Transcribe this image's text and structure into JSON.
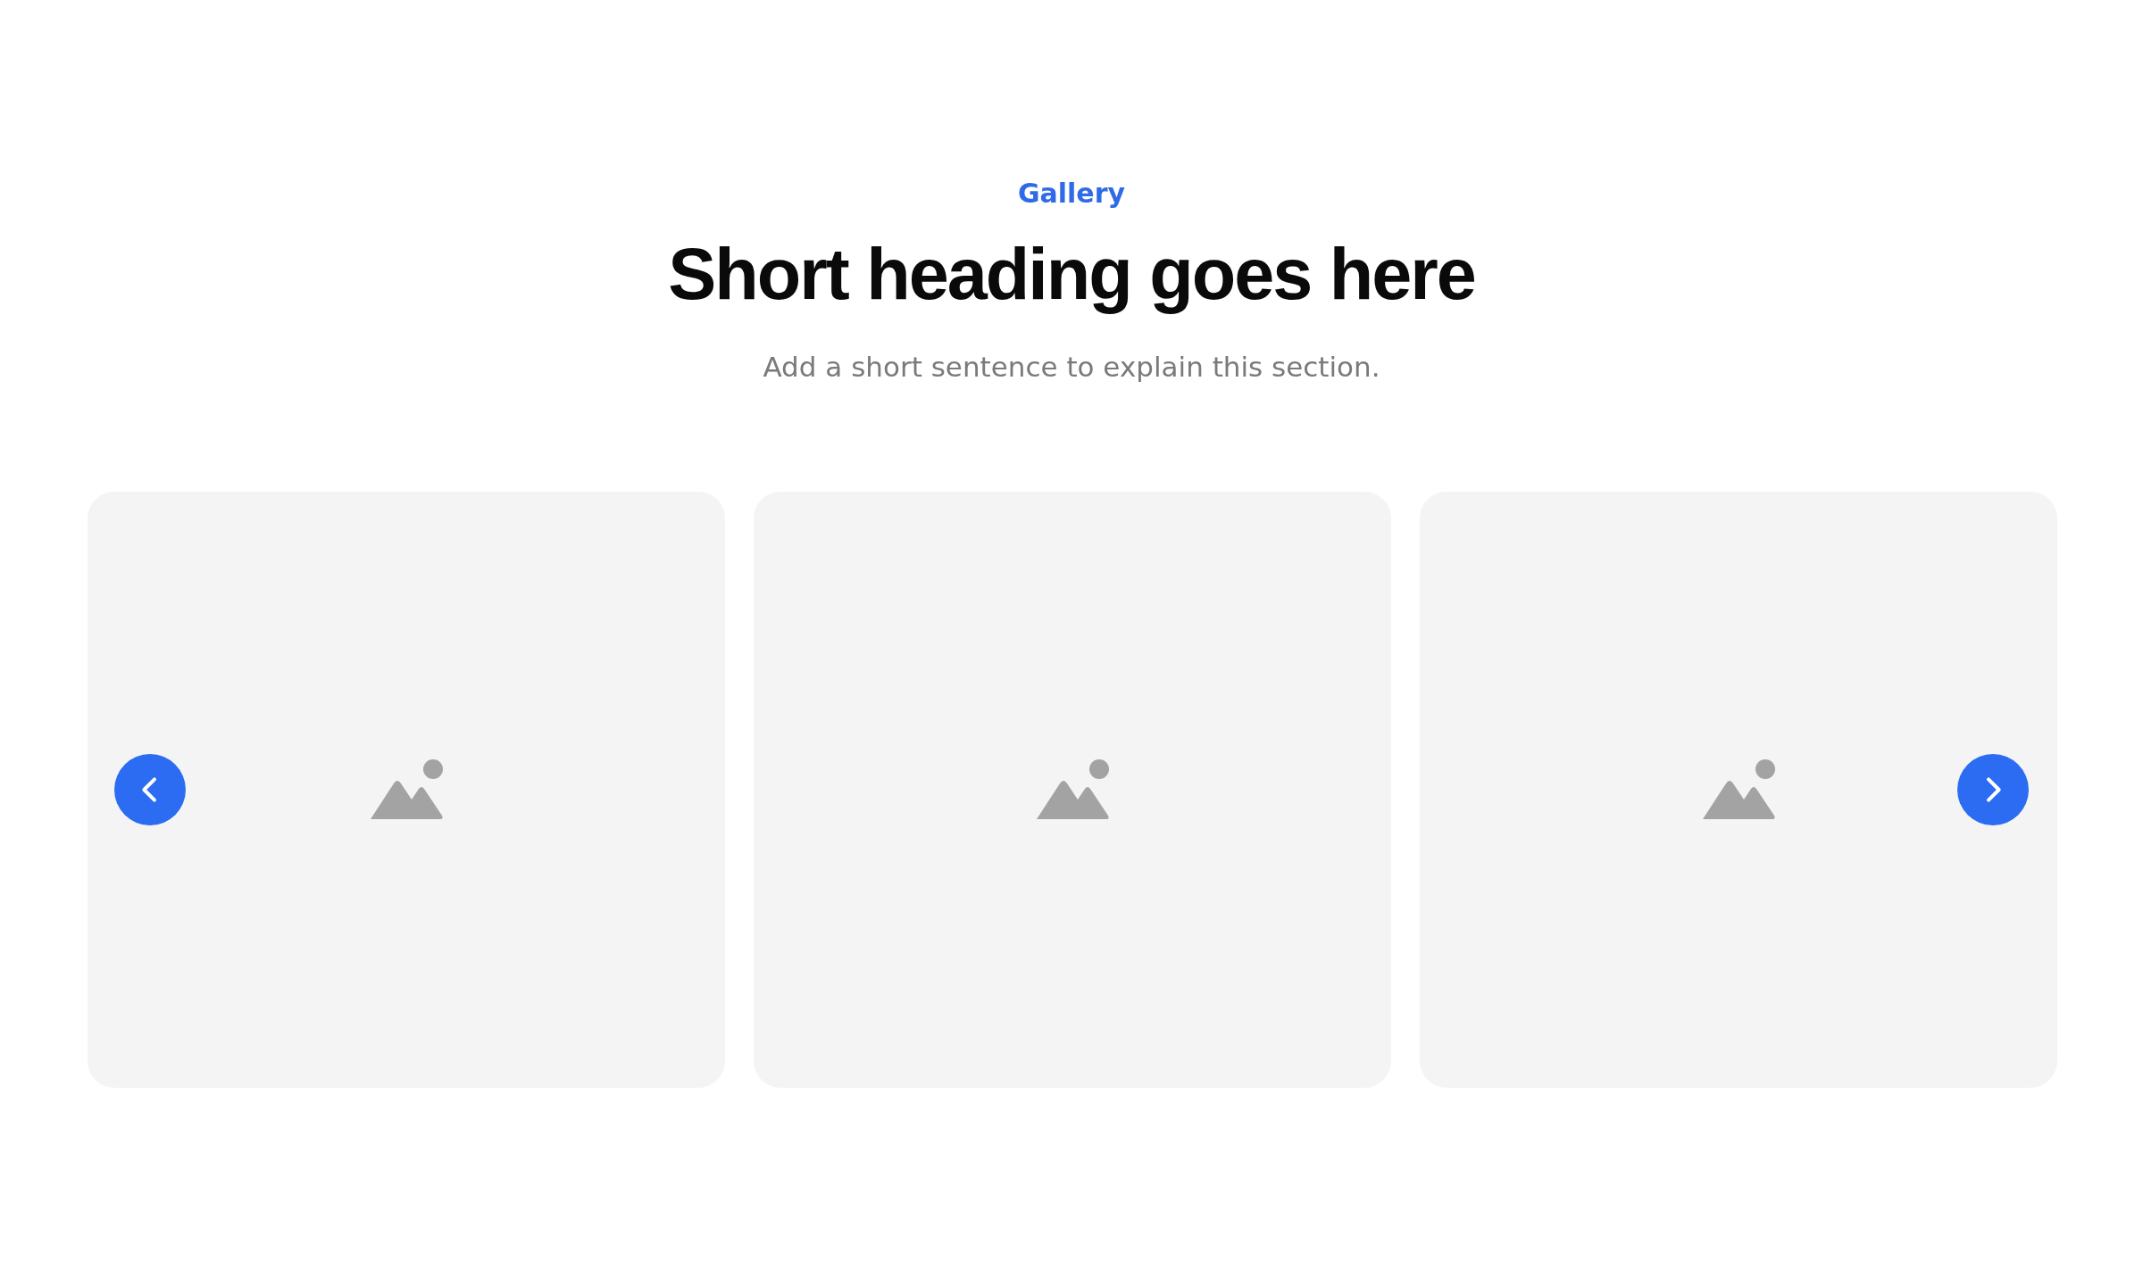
{
  "section": {
    "eyebrow": "Gallery",
    "heading": "Short heading goes here",
    "description": "Add a short sentence to explain this section."
  },
  "carousel": {
    "previous_button": true,
    "next_button": true,
    "slides": [
      {
        "kind": "placeholder"
      },
      {
        "kind": "placeholder"
      },
      {
        "kind": "placeholder"
      }
    ]
  }
}
